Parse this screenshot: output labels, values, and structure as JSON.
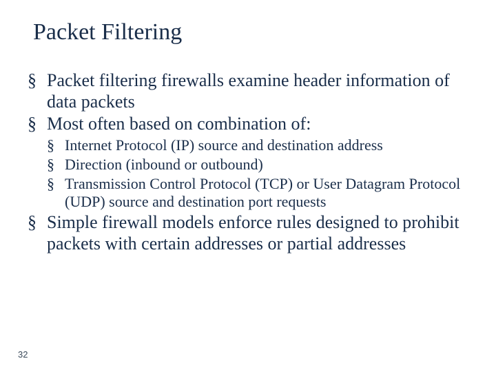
{
  "title": "Packet Filtering",
  "bullets": {
    "b1": "Packet filtering firewalls examine header information of data packets",
    "b2": "Most often based on combination of:",
    "sub": {
      "s1": "Internet Protocol (IP) source and destination address",
      "s2": "Direction (inbound or outbound)",
      "s3": "Transmission Control Protocol (TCP) or User Datagram Protocol (UDP) source and destination port requests"
    },
    "b3": "Simple firewall models enforce rules designed to prohibit packets with certain addresses or partial addresses"
  },
  "page_number": "32"
}
